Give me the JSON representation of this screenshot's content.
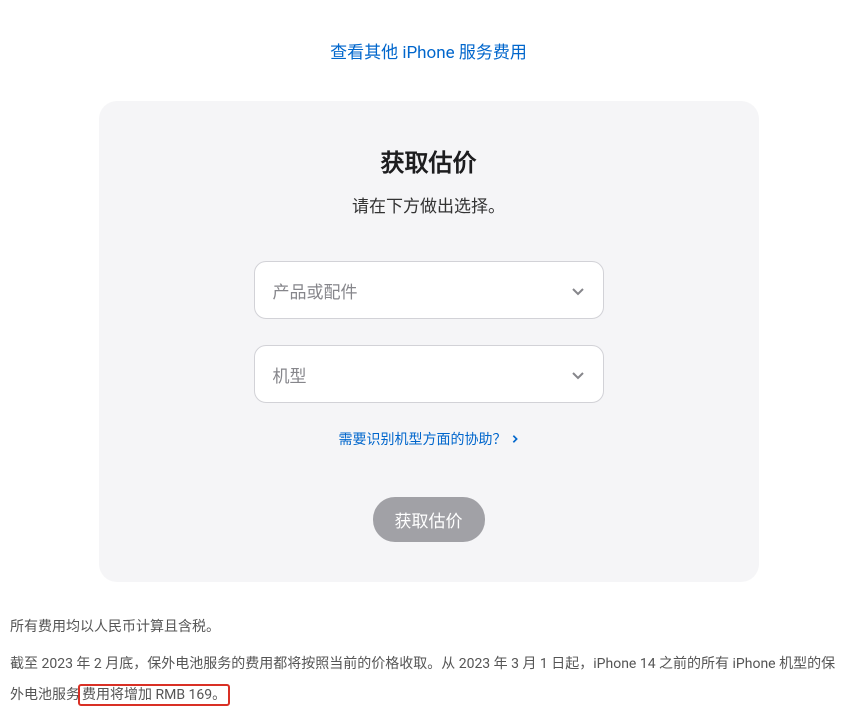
{
  "topLink": {
    "label": "查看其他 iPhone 服务费用"
  },
  "card": {
    "title": "获取估价",
    "subtitle": "请在下方做出选择。",
    "select1": {
      "placeholder": "产品或配件"
    },
    "select2": {
      "placeholder": "机型"
    },
    "helpLink": {
      "label": "需要识别机型方面的协助？"
    },
    "submit": {
      "label": "获取估价"
    }
  },
  "footer": {
    "line1": "所有费用均以人民币计算且含税。",
    "line2_part1": "截至 2023 年 2 月底，保外电池服务的费用都将按照当前的价格收取。从 2023 年 3 月 1 日起，iPhone 14 之前的所有 iPhone 机型的保外电池服务",
    "line2_highlight": "费用将增加 RMB 169。"
  }
}
